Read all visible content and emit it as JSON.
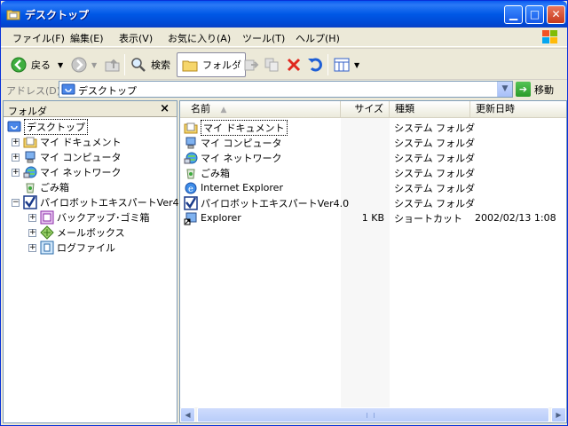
{
  "window": {
    "title": "デスクトップ"
  },
  "menu": [
    "ファイル(F)",
    "編集(E)",
    "表示(V)",
    "お気に入り(A)",
    "ツール(T)",
    "ヘルプ(H)"
  ],
  "toolbar": {
    "back": "戻る",
    "search": "検索",
    "folders": "フォルダ"
  },
  "address": {
    "label": "アドレス(D)",
    "value": "デスクトップ",
    "go": "移動"
  },
  "left_pane": {
    "title": "フォルダ",
    "tree": [
      {
        "label": "デスクトップ"
      },
      {
        "label": "マイ ドキュメント"
      },
      {
        "label": "マイ コンピュータ"
      },
      {
        "label": "マイ ネットワーク"
      },
      {
        "label": "ごみ箱"
      },
      {
        "label": "パイロボットエキスパートVer4.0"
      },
      {
        "label": "バックアップ･ゴミ箱"
      },
      {
        "label": "メールボックス"
      },
      {
        "label": "ログファイル"
      }
    ]
  },
  "columns": {
    "name": "名前",
    "size": "サイズ",
    "type": "種類",
    "date": "更新日時"
  },
  "files": [
    {
      "name": "マイ ドキュメント",
      "size": "",
      "type": "システム フォルダ",
      "date": ""
    },
    {
      "name": "マイ コンピュータ",
      "size": "",
      "type": "システム フォルダ",
      "date": ""
    },
    {
      "name": "マイ ネットワーク",
      "size": "",
      "type": "システム フォルダ",
      "date": ""
    },
    {
      "name": "ごみ箱",
      "size": "",
      "type": "システム フォルダ",
      "date": ""
    },
    {
      "name": "Internet Explorer",
      "size": "",
      "type": "システム フォルダ",
      "date": ""
    },
    {
      "name": "パイロボットエキスパートVer4.0",
      "size": "",
      "type": "システム フォルダ",
      "date": ""
    },
    {
      "name": "Explorer",
      "size": "1 KB",
      "type": "ショートカット",
      "date": "2002/02/13 1:08"
    }
  ]
}
